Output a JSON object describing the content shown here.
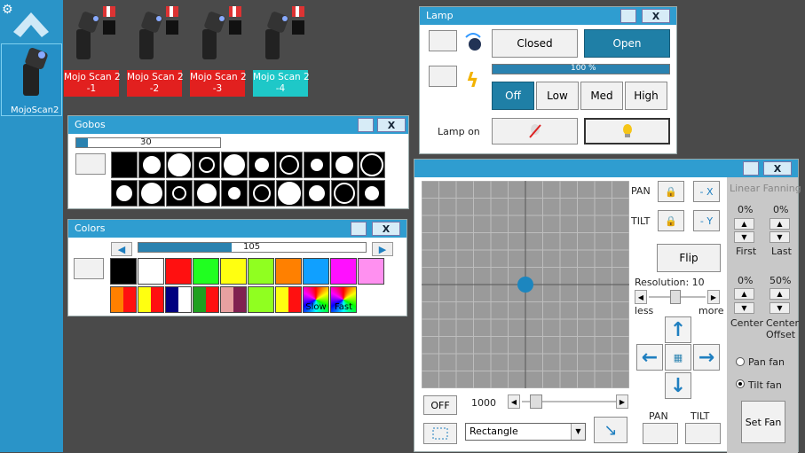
{
  "sidebar": {
    "fixture_label": "MojoScan2"
  },
  "fixtures": [
    {
      "label": "Mojo Scan 2\n-1",
      "color": "#e2201f"
    },
    {
      "label": "Mojo Scan 2\n-2",
      "color": "#e2201f"
    },
    {
      "label": "Mojo Scan 2\n-3",
      "color": "#e2201f"
    },
    {
      "label": "Mojo Scan 2\n-4",
      "color": "#1ec8c8"
    }
  ],
  "gobos": {
    "title": "Gobos",
    "value": "30",
    "close": "X",
    "progress": 0.08
  },
  "colors": {
    "title": "Colors",
    "value": "105",
    "close": "X",
    "progress": 0.41,
    "swatches": [
      "#000000",
      "#ffffff",
      "#ff1010",
      "#20ff20",
      "#ffff10",
      "#90ff20",
      "#ff8000",
      "#10a0ff",
      "#ff10ff",
      "#ff90f0"
    ],
    "slow_label": "Slow",
    "fast_label": "Fast"
  },
  "lamp": {
    "title": "Lamp",
    "close": "X",
    "closed_label": "Closed",
    "open_label": "Open",
    "progress_text": "100 %",
    "progress": 1.0,
    "levels": [
      "Off",
      "Low",
      "Med",
      "High"
    ],
    "lamp_on_label": "Lamp on"
  },
  "position": {
    "close": "X",
    "pan_label": "PAN",
    "tilt_label": "TILT",
    "minus_x": "- X",
    "minus_y": "- Y",
    "flip_label": "Flip",
    "resolution_label": "Resolution: 10",
    "less_label": "less",
    "more_label": "more",
    "off_label": "OFF",
    "speed_value": "1000",
    "shape_value": "Rectangle",
    "pan_bottom_label": "PAN",
    "tilt_bottom_label": "TILT",
    "fanning_title": "Linear Fanning",
    "first_pct": "0%",
    "last_pct": "0%",
    "first_label": "First",
    "last_label": "Last",
    "center_pct": "0%",
    "offset_pct": "50%",
    "center_label": "Center",
    "offset_label": "Center\nOffset",
    "pan_fan_label": "Pan fan",
    "tilt_fan_label": "Tilt fan",
    "set_fan_label": "Set Fan"
  }
}
